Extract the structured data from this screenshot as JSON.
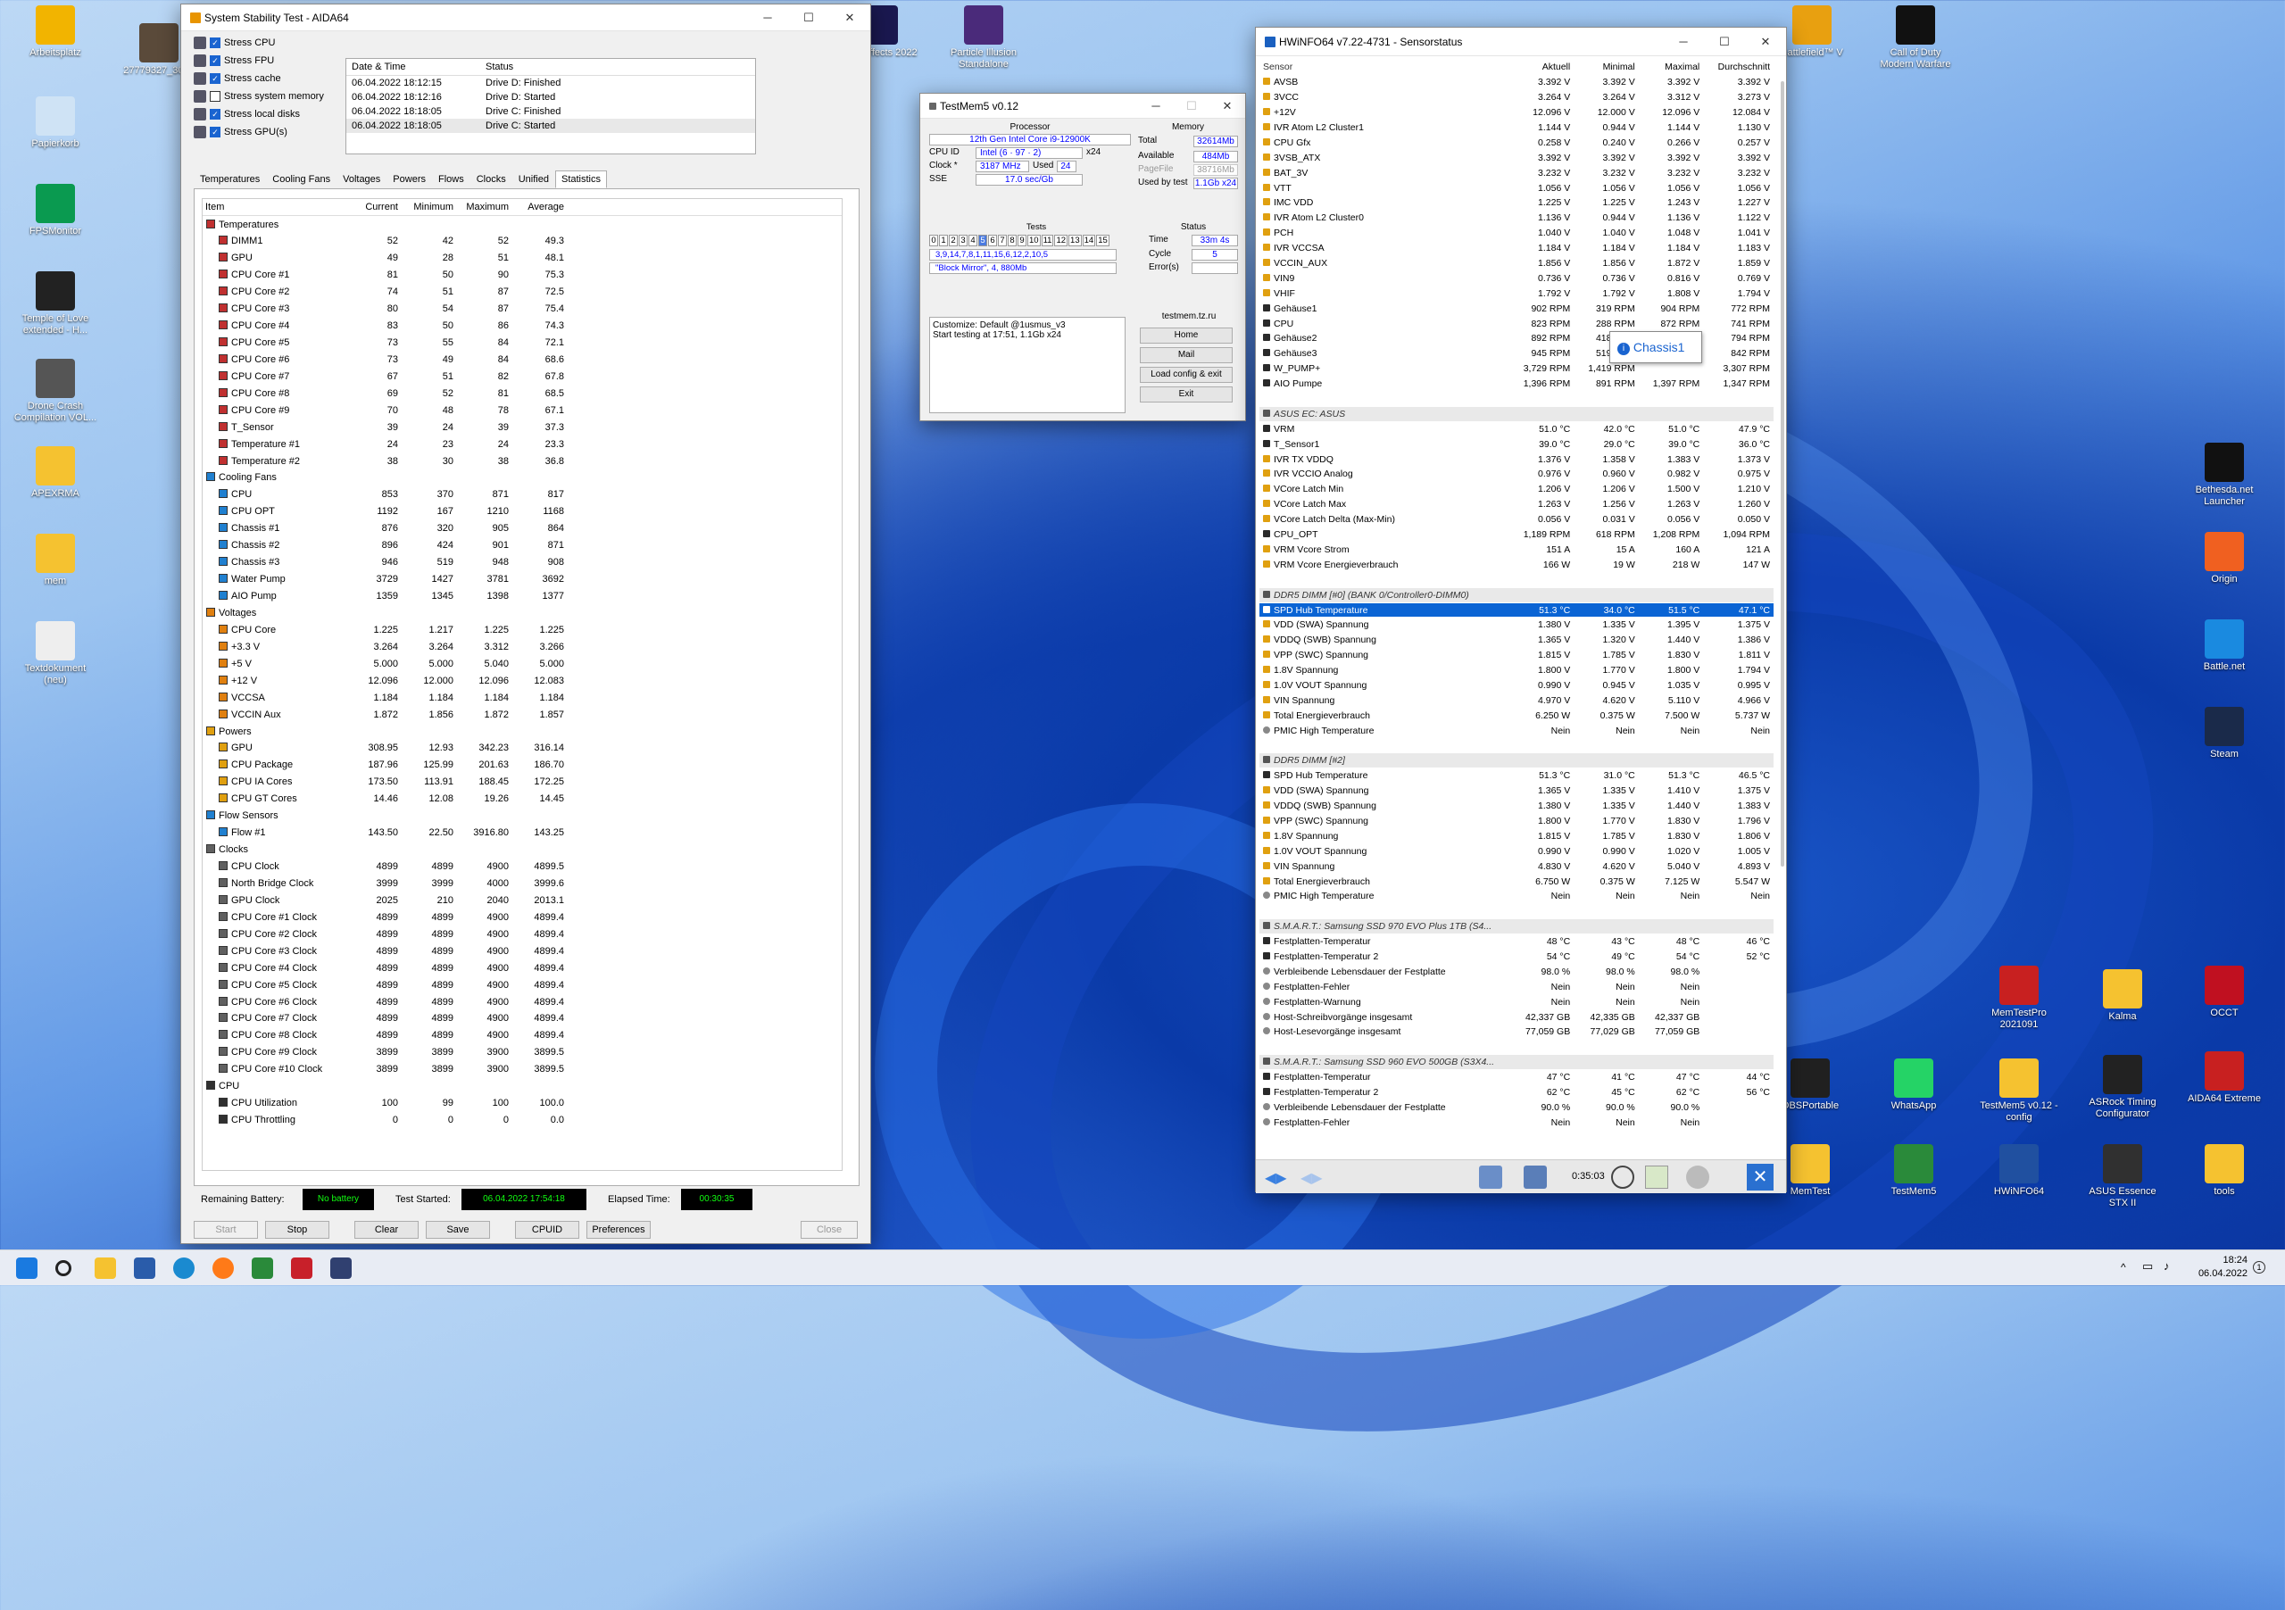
{
  "desktop": {
    "left_icons": [
      "Arbeitsplatz",
      "27779327_3052",
      "Papierkorb",
      "FPSMonitor",
      "Temple of Love extended - H...",
      "Drone Crash Compilation VOL...",
      "APEXRMA",
      "mem",
      "Textdokument (neu)"
    ],
    "top_icons": [
      "After Effects 2022",
      "Particle Illusion Standalone",
      "Battlefield™ V",
      "Call of Duty Modern Warfare"
    ],
    "right_icons": [
      "Bethesda.net Launcher",
      "Origin",
      "Battle.net",
      "Steam",
      "OCCT",
      "Kalma",
      "MemTestPro 2021091",
      "AIDA64 Extreme",
      "ASRock Timing Configurator",
      "TestMem5 v0.12 - config",
      "WhatsApp",
      "OBSPortable",
      "tools",
      "ASUS Essence STX II",
      "HWiNFO64",
      "TestMem5",
      "MemTest"
    ]
  },
  "aida": {
    "title": "System Stability Test - AIDA64",
    "stress": [
      "Stress CPU",
      "Stress FPU",
      "Stress cache",
      "Stress system memory",
      "Stress local disks",
      "Stress GPU(s)"
    ],
    "stress_checked": [
      true,
      true,
      true,
      false,
      true,
      true
    ],
    "log_headers": [
      "Date & Time",
      "Status"
    ],
    "log": [
      [
        "06.04.2022 18:12:15",
        "Drive D: Finished"
      ],
      [
        "06.04.2022 18:12:16",
        "Drive D: Started"
      ],
      [
        "06.04.2022 18:18:05",
        "Drive C: Finished"
      ],
      [
        "06.04.2022 18:18:05",
        "Drive C: Started"
      ]
    ],
    "tabs": [
      "Temperatures",
      "Cooling Fans",
      "Voltages",
      "Powers",
      "Flows",
      "Clocks",
      "Unified",
      "Statistics"
    ],
    "cols": [
      "Item",
      "Current",
      "Minimum",
      "Maximum",
      "Average"
    ],
    "rows": [
      [
        "g",
        "Temperatures",
        "",
        "",
        "",
        ""
      ],
      [
        "i",
        "DIMM1",
        "52",
        "42",
        "52",
        "49.3"
      ],
      [
        "i",
        "GPU",
        "49",
        "28",
        "51",
        "48.1"
      ],
      [
        "i",
        "CPU Core #1",
        "81",
        "50",
        "90",
        "75.3"
      ],
      [
        "i",
        "CPU Core #2",
        "74",
        "51",
        "87",
        "72.5"
      ],
      [
        "i",
        "CPU Core #3",
        "80",
        "54",
        "87",
        "75.4"
      ],
      [
        "i",
        "CPU Core #4",
        "83",
        "50",
        "86",
        "74.3"
      ],
      [
        "i",
        "CPU Core #5",
        "73",
        "55",
        "84",
        "72.1"
      ],
      [
        "i",
        "CPU Core #6",
        "73",
        "49",
        "84",
        "68.6"
      ],
      [
        "i",
        "CPU Core #7",
        "67",
        "51",
        "82",
        "67.8"
      ],
      [
        "i",
        "CPU Core #8",
        "69",
        "52",
        "81",
        "68.5"
      ],
      [
        "i",
        "CPU Core #9",
        "70",
        "48",
        "78",
        "67.1"
      ],
      [
        "i",
        "T_Sensor",
        "39",
        "24",
        "39",
        "37.3"
      ],
      [
        "i",
        "Temperature #1",
        "24",
        "23",
        "24",
        "23.3"
      ],
      [
        "i",
        "Temperature #2",
        "38",
        "30",
        "38",
        "36.8"
      ],
      [
        "g",
        "Cooling Fans",
        "",
        "",
        "",
        ""
      ],
      [
        "i",
        "CPU",
        "853",
        "370",
        "871",
        "817"
      ],
      [
        "i",
        "CPU OPT",
        "1192",
        "167",
        "1210",
        "1168"
      ],
      [
        "i",
        "Chassis #1",
        "876",
        "320",
        "905",
        "864"
      ],
      [
        "i",
        "Chassis #2",
        "896",
        "424",
        "901",
        "871"
      ],
      [
        "i",
        "Chassis #3",
        "946",
        "519",
        "948",
        "908"
      ],
      [
        "i",
        "Water Pump",
        "3729",
        "1427",
        "3781",
        "3692"
      ],
      [
        "i",
        "AIO Pump",
        "1359",
        "1345",
        "1398",
        "1377"
      ],
      [
        "g",
        "Voltages",
        "",
        "",
        "",
        ""
      ],
      [
        "i",
        "CPU Core",
        "1.225",
        "1.217",
        "1.225",
        "1.225"
      ],
      [
        "i",
        "+3.3 V",
        "3.264",
        "3.264",
        "3.312",
        "3.266"
      ],
      [
        "i",
        "+5 V",
        "5.000",
        "5.000",
        "5.040",
        "5.000"
      ],
      [
        "i",
        "+12 V",
        "12.096",
        "12.000",
        "12.096",
        "12.083"
      ],
      [
        "i",
        "VCCSA",
        "1.184",
        "1.184",
        "1.184",
        "1.184"
      ],
      [
        "i",
        "VCCIN Aux",
        "1.872",
        "1.856",
        "1.872",
        "1.857"
      ],
      [
        "g",
        "Powers",
        "",
        "",
        "",
        ""
      ],
      [
        "i",
        "GPU",
        "308.95",
        "12.93",
        "342.23",
        "316.14"
      ],
      [
        "i",
        "CPU Package",
        "187.96",
        "125.99",
        "201.63",
        "186.70"
      ],
      [
        "i",
        "CPU IA Cores",
        "173.50",
        "113.91",
        "188.45",
        "172.25"
      ],
      [
        "i",
        "CPU GT Cores",
        "14.46",
        "12.08",
        "19.26",
        "14.45"
      ],
      [
        "g",
        "Flow Sensors",
        "",
        "",
        "",
        ""
      ],
      [
        "i",
        "Flow #1",
        "143.50",
        "22.50",
        "3916.80",
        "143.25"
      ],
      [
        "g",
        "Clocks",
        "",
        "",
        "",
        ""
      ],
      [
        "i",
        "CPU Clock",
        "4899",
        "4899",
        "4900",
        "4899.5"
      ],
      [
        "i",
        "North Bridge Clock",
        "3999",
        "3999",
        "4000",
        "3999.6"
      ],
      [
        "i",
        "GPU Clock",
        "2025",
        "210",
        "2040",
        "2013.1"
      ],
      [
        "i",
        "CPU Core #1 Clock",
        "4899",
        "4899",
        "4900",
        "4899.4"
      ],
      [
        "i",
        "CPU Core #2 Clock",
        "4899",
        "4899",
        "4900",
        "4899.4"
      ],
      [
        "i",
        "CPU Core #3 Clock",
        "4899",
        "4899",
        "4900",
        "4899.4"
      ],
      [
        "i",
        "CPU Core #4 Clock",
        "4899",
        "4899",
        "4900",
        "4899.4"
      ],
      [
        "i",
        "CPU Core #5 Clock",
        "4899",
        "4899",
        "4900",
        "4899.4"
      ],
      [
        "i",
        "CPU Core #6 Clock",
        "4899",
        "4899",
        "4900",
        "4899.4"
      ],
      [
        "i",
        "CPU Core #7 Clock",
        "4899",
        "4899",
        "4900",
        "4899.4"
      ],
      [
        "i",
        "CPU Core #8 Clock",
        "4899",
        "4899",
        "4900",
        "4899.4"
      ],
      [
        "i",
        "CPU Core #9 Clock",
        "3899",
        "3899",
        "3900",
        "3899.5"
      ],
      [
        "i",
        "CPU Core #10 Clock",
        "3899",
        "3899",
        "3900",
        "3899.5"
      ],
      [
        "g",
        "CPU",
        "",
        "",
        "",
        ""
      ],
      [
        "i",
        "CPU Utilization",
        "100",
        "99",
        "100",
        "100.0"
      ],
      [
        "i",
        "CPU Throttling",
        "0",
        "0",
        "0",
        "0.0"
      ]
    ],
    "remaining_label": "Remaining Battery:",
    "remaining": "No battery",
    "started_label": "Test Started:",
    "started": "06.04.2022 17:54:18",
    "elapsed_label": "Elapsed Time:",
    "elapsed": "00:30:35",
    "buttons": [
      "Start",
      "Stop",
      "Clear",
      "Save",
      "CPUID",
      "Preferences",
      "Close"
    ]
  },
  "tm5": {
    "title": "TestMem5 v0.12",
    "processor_h": "Processor",
    "memory_h": "Memory",
    "cpu_name": "12th Gen Intel Core i9-12900K",
    "cpu_id_l": "CPU ID",
    "cpu_id": "Intel (6 · 97 · 2)",
    "x24": "x24",
    "clock_l": "Clock *",
    "clock": "3187 MHz",
    "used_l": "Used",
    "used": "24",
    "sse_l": "SSE",
    "sse": "17.0 sec/Gb",
    "total_l": "Total",
    "total": "32614Mb",
    "avail_l": "Available",
    "avail": "484Mb",
    "pagefile_l": "PageFile",
    "pagefile": "38716Mb",
    "usedtest_l": "Used by test",
    "usedtest": "1.1Gb x24",
    "tests_h": "Tests",
    "test_nums": [
      "0",
      "1",
      "2",
      "3",
      "4",
      "5",
      "6",
      "7",
      "8",
      "9",
      "10",
      "11",
      "12",
      "13",
      "14",
      "15"
    ],
    "seq": "3,9,14,7,8,1,11,15,6,12,2,10,5",
    "mirror": "\"Block Mirror\", 4, 880Mb",
    "status_h": "Status",
    "time_l": "Time",
    "time": "33m 4s",
    "cycle_l": "Cycle",
    "cycle": "5",
    "errors_l": "Error(s)",
    "errors": "",
    "log1": "Customize: Default @1usmus_v3",
    "log2": "Start testing at 17:51, 1.1Gb x24",
    "site": "testmem.tz.ru",
    "btns": [
      "Home",
      "Mail",
      "Load config & exit",
      "Exit"
    ]
  },
  "hw": {
    "title": "HWiNFO64 v7.22-4731 - Sensorstatus",
    "cols": [
      "Sensor",
      "Aktuell",
      "Minimal",
      "Maximal",
      "Durchschnitt"
    ],
    "rows": [
      [
        "v",
        "AVSB",
        "3.392 V",
        "3.392 V",
        "3.392 V",
        "3.392 V"
      ],
      [
        "v",
        "3VCC",
        "3.264 V",
        "3.264 V",
        "3.312 V",
        "3.273 V"
      ],
      [
        "v",
        "+12V",
        "12.096 V",
        "12.000 V",
        "12.096 V",
        "12.084 V"
      ],
      [
        "v",
        "IVR Atom L2 Cluster1",
        "1.144 V",
        "0.944 V",
        "1.144 V",
        "1.130 V"
      ],
      [
        "v",
        "CPU Gfx",
        "0.258 V",
        "0.240 V",
        "0.266 V",
        "0.257 V"
      ],
      [
        "v",
        "3VSB_ATX",
        "3.392 V",
        "3.392 V",
        "3.392 V",
        "3.392 V"
      ],
      [
        "v",
        "BAT_3V",
        "3.232 V",
        "3.232 V",
        "3.232 V",
        "3.232 V"
      ],
      [
        "v",
        "VTT",
        "1.056 V",
        "1.056 V",
        "1.056 V",
        "1.056 V"
      ],
      [
        "v",
        "IMC VDD",
        "1.225 V",
        "1.225 V",
        "1.243 V",
        "1.227 V"
      ],
      [
        "v",
        "IVR Atom L2 Cluster0",
        "1.136 V",
        "0.944 V",
        "1.136 V",
        "1.122 V"
      ],
      [
        "v",
        "PCH",
        "1.040 V",
        "1.040 V",
        "1.048 V",
        "1.041 V"
      ],
      [
        "v",
        "IVR VCCSA",
        "1.184 V",
        "1.184 V",
        "1.184 V",
        "1.183 V"
      ],
      [
        "v",
        "VCCIN_AUX",
        "1.856 V",
        "1.856 V",
        "1.872 V",
        "1.859 V"
      ],
      [
        "v",
        "VIN9",
        "0.736 V",
        "0.736 V",
        "0.816 V",
        "0.769 V"
      ],
      [
        "v",
        "VHIF",
        "1.792 V",
        "1.792 V",
        "1.808 V",
        "1.794 V"
      ],
      [
        "f",
        "Gehäuse1",
        "902 RPM",
        "319 RPM",
        "904 RPM",
        "772 RPM"
      ],
      [
        "f",
        "CPU",
        "823 RPM",
        "288 RPM",
        "872 RPM",
        "741 RPM"
      ],
      [
        "f",
        "Gehäuse2",
        "892 RPM",
        "418 RPM",
        "",
        "794 RPM"
      ],
      [
        "f",
        "Gehäuse3",
        "945 RPM",
        "519 RPM",
        "",
        "842 RPM"
      ],
      [
        "f",
        "W_PUMP+",
        "3,729 RPM",
        "1,419 RPM",
        "",
        "3,307 RPM"
      ],
      [
        "f",
        "AIO Pumpe",
        "1,396 RPM",
        "891 RPM",
        "1,397 RPM",
        "1,347 RPM"
      ],
      [
        "b",
        "",
        "",
        "",
        "",
        ""
      ],
      [
        "s",
        "ASUS EC: ASUS",
        "",
        "",
        "",
        ""
      ],
      [
        "t",
        "VRM",
        "51.0 °C",
        "42.0 °C",
        "51.0 °C",
        "47.9 °C"
      ],
      [
        "t",
        "T_Sensor1",
        "39.0 °C",
        "29.0 °C",
        "39.0 °C",
        "36.0 °C"
      ],
      [
        "v",
        "IVR TX VDDQ",
        "1.376 V",
        "1.358 V",
        "1.383 V",
        "1.373 V"
      ],
      [
        "v",
        "IVR VCCIO Analog",
        "0.976 V",
        "0.960 V",
        "0.982 V",
        "0.975 V"
      ],
      [
        "v",
        "VCore Latch Min",
        "1.206 V",
        "1.206 V",
        "1.500 V",
        "1.210 V"
      ],
      [
        "v",
        "VCore Latch Max",
        "1.263 V",
        "1.256 V",
        "1.263 V",
        "1.260 V"
      ],
      [
        "v",
        "VCore Latch Delta (Max-Min)",
        "0.056 V",
        "0.031 V",
        "0.056 V",
        "0.050 V"
      ],
      [
        "f",
        "CPU_OPT",
        "1,189 RPM",
        "618 RPM",
        "1,208 RPM",
        "1,094 RPM"
      ],
      [
        "p",
        "VRM Vcore Strom",
        "151 A",
        "15 A",
        "160 A",
        "121 A"
      ],
      [
        "p",
        "VRM Vcore Energieverbrauch",
        "166 W",
        "19 W",
        "218 W",
        "147 W"
      ],
      [
        "b",
        "",
        "",
        "",
        "",
        ""
      ],
      [
        "s",
        "DDR5 DIMM [#0] (BANK 0/Controller0-DIMM0)",
        "",
        "",
        "",
        ""
      ],
      [
        "sel",
        "SPD Hub Temperature",
        "51.3 °C",
        "34.0 °C",
        "51.5 °C",
        "47.1 °C"
      ],
      [
        "v",
        "VDD (SWA) Spannung",
        "1.380 V",
        "1.335 V",
        "1.395 V",
        "1.375 V"
      ],
      [
        "v",
        "VDDQ (SWB) Spannung",
        "1.365 V",
        "1.320 V",
        "1.440 V",
        "1.386 V"
      ],
      [
        "v",
        "VPP (SWC) Spannung",
        "1.815 V",
        "1.785 V",
        "1.830 V",
        "1.811 V"
      ],
      [
        "v",
        "1.8V Spannung",
        "1.800 V",
        "1.770 V",
        "1.800 V",
        "1.794 V"
      ],
      [
        "v",
        "1.0V VOUT Spannung",
        "0.990 V",
        "0.945 V",
        "1.035 V",
        "0.995 V"
      ],
      [
        "v",
        "VIN Spannung",
        "4.970 V",
        "4.620 V",
        "5.110 V",
        "4.966 V"
      ],
      [
        "p",
        "Total Energieverbrauch",
        "6.250 W",
        "0.375 W",
        "7.500 W",
        "5.737 W"
      ],
      [
        "o",
        "PMIC High Temperature",
        "Nein",
        "Nein",
        "Nein",
        "Nein"
      ],
      [
        "b",
        "",
        "",
        "",
        "",
        ""
      ],
      [
        "s",
        "DDR5 DIMM [#2]",
        "",
        "",
        "",
        ""
      ],
      [
        "t",
        "SPD Hub Temperature",
        "51.3 °C",
        "31.0 °C",
        "51.3 °C",
        "46.5 °C"
      ],
      [
        "v",
        "VDD (SWA) Spannung",
        "1.365 V",
        "1.335 V",
        "1.410 V",
        "1.375 V"
      ],
      [
        "v",
        "VDDQ (SWB) Spannung",
        "1.380 V",
        "1.335 V",
        "1.440 V",
        "1.383 V"
      ],
      [
        "v",
        "VPP (SWC) Spannung",
        "1.800 V",
        "1.770 V",
        "1.830 V",
        "1.796 V"
      ],
      [
        "v",
        "1.8V Spannung",
        "1.815 V",
        "1.785 V",
        "1.830 V",
        "1.806 V"
      ],
      [
        "v",
        "1.0V VOUT Spannung",
        "0.990 V",
        "0.990 V",
        "1.020 V",
        "1.005 V"
      ],
      [
        "v",
        "VIN Spannung",
        "4.830 V",
        "4.620 V",
        "5.040 V",
        "4.893 V"
      ],
      [
        "p",
        "Total Energieverbrauch",
        "6.750 W",
        "0.375 W",
        "7.125 W",
        "5.547 W"
      ],
      [
        "o",
        "PMIC High Temperature",
        "Nein",
        "Nein",
        "Nein",
        "Nein"
      ],
      [
        "b",
        "",
        "",
        "",
        "",
        ""
      ],
      [
        "s",
        "S.M.A.R.T.: Samsung SSD 970 EVO Plus 1TB (S4...",
        "",
        "",
        "",
        ""
      ],
      [
        "t",
        "Festplatten-Temperatur",
        "48 °C",
        "43 °C",
        "48 °C",
        "46 °C"
      ],
      [
        "t",
        "Festplatten-Temperatur 2",
        "54 °C",
        "49 °C",
        "54 °C",
        "52 °C"
      ],
      [
        "o",
        "Verbleibende Lebensdauer der Festplatte",
        "98.0 %",
        "98.0 %",
        "98.0 %",
        ""
      ],
      [
        "o",
        "Festplatten-Fehler",
        "Nein",
        "Nein",
        "Nein",
        ""
      ],
      [
        "o",
        "Festplatten-Warnung",
        "Nein",
        "Nein",
        "Nein",
        ""
      ],
      [
        "o",
        "Host-Schreibvorgänge insgesamt",
        "42,337 GB",
        "42,335 GB",
        "42,337 GB",
        ""
      ],
      [
        "o",
        "Host-Lesevorgänge insgesamt",
        "77,059 GB",
        "77,029 GB",
        "77,059 GB",
        ""
      ],
      [
        "b",
        "",
        "",
        "",
        "",
        ""
      ],
      [
        "s",
        "S.M.A.R.T.: Samsung SSD 960 EVO 500GB (S3X4...",
        "",
        "",
        "",
        ""
      ],
      [
        "t",
        "Festplatten-Temperatur",
        "47 °C",
        "41 °C",
        "47 °C",
        "44 °C"
      ],
      [
        "t",
        "Festplatten-Temperatur 2",
        "62 °C",
        "45 °C",
        "62 °C",
        "56 °C"
      ],
      [
        "o",
        "Verbleibende Lebensdauer der Festplatte",
        "90.0 %",
        "90.0 %",
        "90.0 %",
        ""
      ],
      [
        "o",
        "Festplatten-Fehler",
        "Nein",
        "Nein",
        "Nein",
        ""
      ]
    ],
    "tooltip": "Chassis1",
    "timer": "0:35:03"
  },
  "taskbar": {
    "time": "18:24",
    "date": "06.04.2022"
  }
}
